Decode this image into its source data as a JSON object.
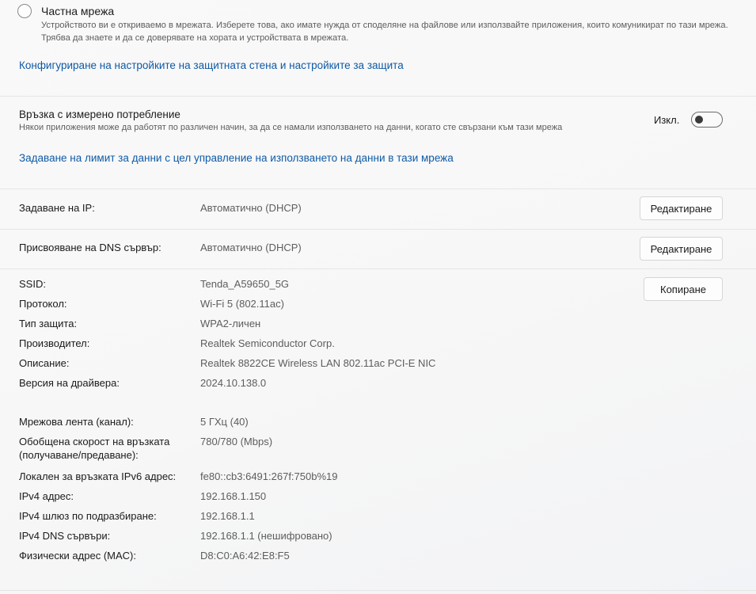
{
  "private_network": {
    "title": "Частна мрежа",
    "description": "Устройството ви е откриваемо в мрежата. Изберете това, ако имате нужда от споделяне на файлове или използвайте приложения, които комуникират по тази мрежа. Трябва да знаете и да се доверявате на хората и устройствата в мрежата."
  },
  "firewall_link": "Конфигуриране на настройките на защитната стена и настройките за защита",
  "metered": {
    "title": "Връзка с измерено потребление",
    "description": "Някои приложения може да работят по различен начин, за да се намали използването на данни, когато сте свързани към тази мрежа",
    "toggle_state": "Изкл.",
    "toggle_on": false
  },
  "data_limit_link": "Задаване на лимит за данни с цел управление на използването на данни в тази мрежа",
  "ip_assignment": {
    "label": "Задаване на IP:",
    "value": "Автоматично (DHCP)",
    "button": "Редактиране"
  },
  "dns_assignment": {
    "label": "Присвояване на DNS сървър:",
    "value": "Автоматично (DHCP)",
    "button": "Редактиране"
  },
  "copy_button": "Копиране",
  "properties": [
    {
      "key": "SSID:",
      "value": "Tenda_A59650_5G"
    },
    {
      "key": "Протокол:",
      "value": "Wi-Fi 5 (802.11ac)"
    },
    {
      "key": "Тип защита:",
      "value": "WPA2-личен"
    },
    {
      "key": "Производител:",
      "value": "Realtek Semiconductor Corp."
    },
    {
      "key": "Описание:",
      "value": "Realtek 8822CE Wireless LAN 802.11ac PCI-E NIC"
    },
    {
      "key": "Версия на драйвера:",
      "value": "2024.10.138.0"
    },
    {
      "key": "Мрежова лента (канал):",
      "value": "5 ГХц (40)"
    },
    {
      "key": "Обобщена скорост на връзката\n(получаване/предаване):",
      "value": "780/780 (Mbps)"
    },
    {
      "key": "Локален за връзката IPv6 адрес:",
      "value": "fe80::cb3:6491:267f:750b%19"
    },
    {
      "key": "IPv4 адрес:",
      "value": "192.168.1.150"
    },
    {
      "key": "IPv4 шлюз по подразбиране:",
      "value": "192.168.1.1"
    },
    {
      "key": "IPv4 DNS сървъри:",
      "value": "192.168.1.1 (нешифровано)"
    },
    {
      "key": "Физически адрес (MAC):",
      "value": "D8:C0:A6:42:E8:F5"
    }
  ]
}
